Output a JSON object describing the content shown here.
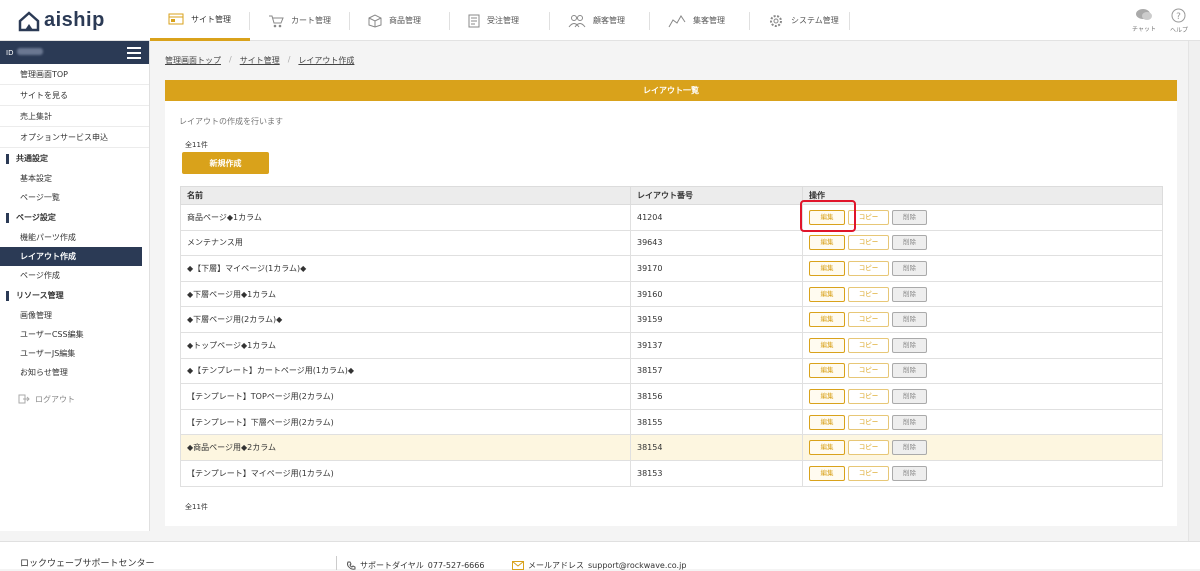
{
  "app": {
    "logo_text": "aiship"
  },
  "nav": {
    "items": [
      {
        "label": "サイト管理",
        "icon": "layout-icon",
        "active": true
      },
      {
        "label": "カート管理",
        "icon": "cart-icon"
      },
      {
        "label": "商品管理",
        "icon": "box-icon"
      },
      {
        "label": "受注管理",
        "icon": "order-icon"
      },
      {
        "label": "顧客管理",
        "icon": "users-icon"
      },
      {
        "label": "集客管理",
        "icon": "chart-icon"
      },
      {
        "label": "システム管理",
        "icon": "gear-icon"
      }
    ]
  },
  "tools": {
    "chat": "チャット",
    "help": "ヘルプ"
  },
  "sidebar": {
    "id_label": "ID",
    "top_items": [
      "管理画面TOP",
      "サイトを見る",
      "売上集計",
      "オプションサービス申込"
    ],
    "sections": [
      {
        "title": "共通設定",
        "items": [
          "基本設定",
          "ページ一覧"
        ]
      },
      {
        "title": "ページ設定",
        "items": [
          "機能パーツ作成",
          "レイアウト作成",
          "ページ作成"
        ]
      },
      {
        "title": "リソース管理",
        "items": [
          "画像管理",
          "ユーザーCSS編集",
          "ユーザーJS編集",
          "お知らせ管理"
        ]
      }
    ],
    "logout": "ログアウト"
  },
  "breadcrumb": {
    "items": [
      "管理画面トップ",
      "サイト管理",
      "レイアウト作成"
    ],
    "sep": "/"
  },
  "panel": {
    "title": "レイアウト一覧",
    "description": "レイアウトの作成を行います",
    "count_top": "全11件",
    "new_button": "新規作成",
    "count_bottom": "全11件"
  },
  "table": {
    "headers": [
      "名前",
      "レイアウト番号",
      "操作"
    ],
    "actions": {
      "edit": "編集",
      "copy": "コピー",
      "delete": "削除"
    },
    "rows": [
      {
        "name": "商品ページ◆1カラム",
        "number": "41204"
      },
      {
        "name": "メンテナンス用",
        "number": "39643"
      },
      {
        "name": "◆【下層】マイページ(1カラム)◆",
        "number": "39170"
      },
      {
        "name": "◆下層ページ用◆1カラム",
        "number": "39160"
      },
      {
        "name": "◆下層ページ用(2カラム)◆",
        "number": "39159"
      },
      {
        "name": "◆トップページ◆1カラム",
        "number": "39137"
      },
      {
        "name": "◆【テンプレート】カートページ用(1カラム)◆",
        "number": "38157"
      },
      {
        "name": "【テンプレート】TOPページ用(2カラム)",
        "number": "38156"
      },
      {
        "name": "【テンプレート】下層ページ用(2カラム)",
        "number": "38155"
      },
      {
        "name": "◆商品ページ用◆2カラム",
        "number": "38154",
        "highlight": true
      },
      {
        "name": "【テンプレート】マイページ用(1カラム)",
        "number": "38153"
      }
    ]
  },
  "footer": {
    "title": "ロックウェーブサポートセンター",
    "phone_label": "サポートダイヤル",
    "phone": "077-527-6666",
    "mail_label": "メールアドレス",
    "mail": "support@rockwave.co.jp"
  },
  "colors": {
    "accent": "#d9a21b",
    "navy": "#2b3a55",
    "highlight_row": "#fdf6e0",
    "focus": "#e0142a"
  }
}
